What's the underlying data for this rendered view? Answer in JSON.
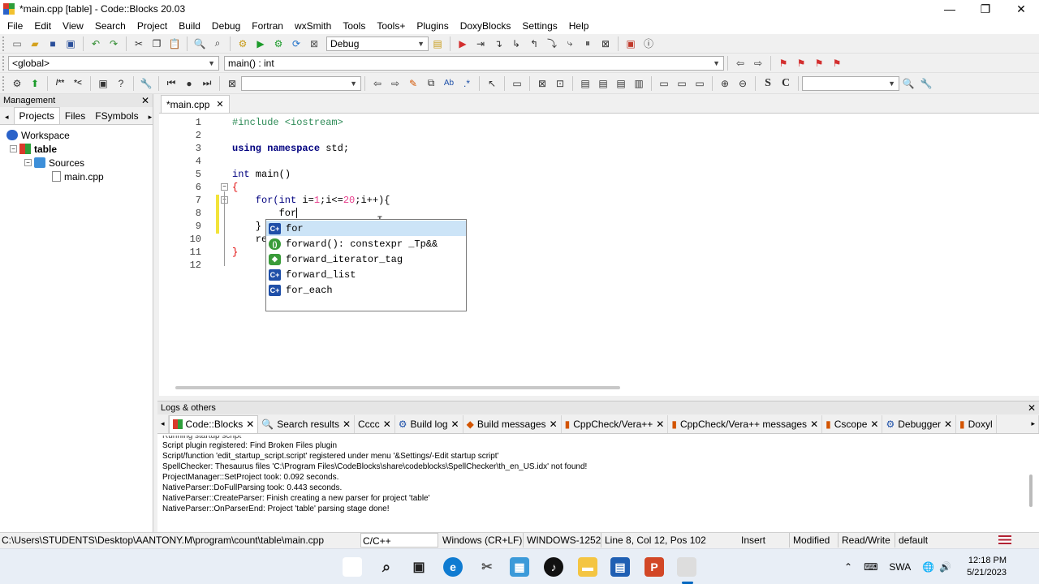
{
  "window": {
    "title": "*main.cpp [table] - Code::Blocks 20.03",
    "minimize": "—",
    "maximize": "❐",
    "close": "✕"
  },
  "menu": [
    "File",
    "Edit",
    "View",
    "Search",
    "Project",
    "Build",
    "Debug",
    "Fortran",
    "wxSmith",
    "Tools",
    "Tools+",
    "Plugins",
    "DoxyBlocks",
    "Settings",
    "Help"
  ],
  "toolbar": {
    "build_target": "Debug",
    "scope_combo": "<global>",
    "function_combo": "main() : int",
    "search_combo": "",
    "search_combo2": "",
    "style_s": "S",
    "style_c": "C"
  },
  "management": {
    "title": "Management",
    "tabs": [
      "Projects",
      "Files",
      "FSymbols"
    ],
    "tree": {
      "workspace": "Workspace",
      "project": "table",
      "folder": "Sources",
      "file": "main.cpp"
    }
  },
  "editor": {
    "tab_label": "*main.cpp",
    "line_numbers": [
      "1",
      "2",
      "3",
      "4",
      "5",
      "6",
      "7",
      "8",
      "9",
      "10",
      "11",
      "12"
    ],
    "code": {
      "l1": "#include <iostream>",
      "l3_kw": "using namespace",
      "l3_rest": " std;",
      "l5_kw": "int",
      "l5_rest": " main()",
      "l6": "{",
      "l7_a": "    for(",
      "l7_kw": "int",
      "l7_b": " i=",
      "l7_n1": "1",
      "l7_c": ";i<=",
      "l7_n2": "20",
      "l7_d": ";i++){",
      "l8": "        for",
      "l9": "    }",
      "l10": "    re",
      "l11": "}"
    }
  },
  "autocomplete": {
    "items": [
      {
        "icon": "C+",
        "label": "for"
      },
      {
        "icon": "()",
        "label": "forward(): constexpr _Tp&&"
      },
      {
        "icon": "◆",
        "label": "forward_iterator_tag"
      },
      {
        "icon": "C+",
        "label": "forward_list"
      },
      {
        "icon": "C+",
        "label": "for_each"
      }
    ]
  },
  "logs": {
    "title": "Logs & others",
    "tabs": [
      "Code::Blocks",
      "Search results",
      "Cccc",
      "Build log",
      "Build messages",
      "CppCheck/Vera++",
      "CppCheck/Vera++ messages",
      "Cscope",
      "Debugger",
      "Doxyl"
    ],
    "lines": [
      "Running startup script",
      "Script plugin registered: Find Broken Files plugin",
      "Script/function 'edit_startup_script.script' registered under menu '&Settings/-Edit startup script'",
      "SpellChecker: Thesaurus files 'C:\\Program Files\\CodeBlocks\\share\\codeblocks\\SpellChecker\\th_en_US.idx' not found!",
      "ProjectManager::SetProject took: 0.092 seconds.",
      "NativeParser::DoFullParsing took: 0.443 seconds.",
      "NativeParser::CreateParser: Finish creating a new parser for project 'table'",
      "NativeParser::OnParserEnd: Project 'table' parsing stage done!"
    ]
  },
  "status": {
    "path": "C:\\Users\\STUDENTS\\Desktop\\AANTONY.M\\program\\count\\table\\main.cpp",
    "language": "C/C++",
    "eol": "Windows (CR+LF)",
    "encoding": "WINDOWS-1252",
    "position": "Line 8, Col 12, Pos 102",
    "insert": "Insert",
    "modified": "Modified",
    "readwrite": "Read/Write",
    "profile": "default"
  },
  "taskbar": {
    "language": "SWA",
    "time": "12:18 PM",
    "date": "5/21/2023"
  }
}
